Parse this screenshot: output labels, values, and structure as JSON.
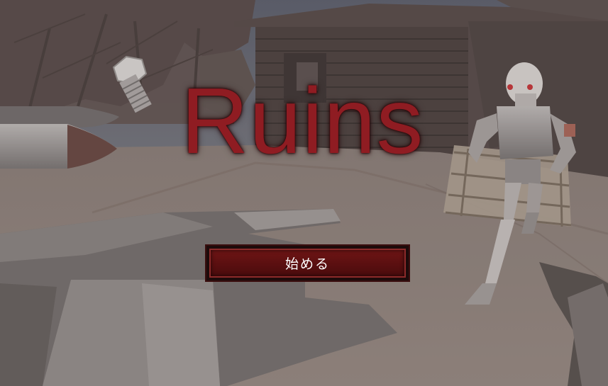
{
  "game": {
    "title": "Ruins",
    "start_label": "始める"
  },
  "colors": {
    "title": "#8f1c22",
    "button_fill": "#5a0f10",
    "button_border": "#8d2a2a",
    "sky": "#5b5f6c",
    "ground": "#7b706b"
  },
  "scene_objects": [
    "tree-icon",
    "bolt-icon",
    "bullet-icon",
    "log-cabin-icon",
    "robot-icon",
    "wooden-pallet-icon",
    "aircraft-wreck-icon"
  ]
}
